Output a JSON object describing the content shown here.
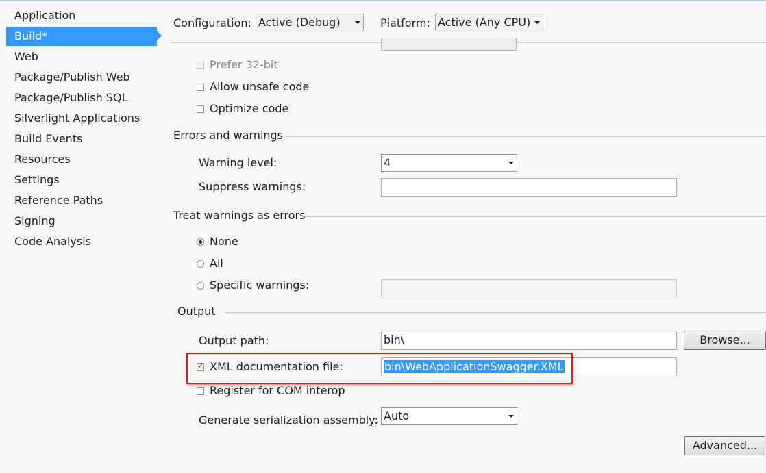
{
  "sidebar": {
    "items": [
      {
        "label": "Application"
      },
      {
        "label": "Build*"
      },
      {
        "label": "Web"
      },
      {
        "label": "Package/Publish Web"
      },
      {
        "label": "Package/Publish SQL"
      },
      {
        "label": "Silverlight Applications"
      },
      {
        "label": "Build Events"
      },
      {
        "label": "Resources"
      },
      {
        "label": "Settings"
      },
      {
        "label": "Reference Paths"
      },
      {
        "label": "Signing"
      },
      {
        "label": "Code Analysis"
      }
    ],
    "active_index": 1
  },
  "header": {
    "configuration_label": "Configuration:",
    "configuration_value": "Active (Debug)",
    "platform_label": "Platform:",
    "platform_value": "Active (Any CPU)"
  },
  "general": {
    "prefer32_label": "Prefer 32-bit",
    "unsafe_label": "Allow unsafe code",
    "optimize_label": "Optimize code"
  },
  "errors": {
    "title": "Errors and warnings",
    "warning_level_label": "Warning level:",
    "warning_level_value": "4",
    "suppress_label": "Suppress warnings:",
    "suppress_value": ""
  },
  "treat": {
    "title": "Treat warnings as errors",
    "none_label": "None",
    "all_label": "All",
    "specific_label": "Specific warnings:",
    "specific_value": ""
  },
  "output": {
    "title": "Output",
    "path_label": "Output path:",
    "path_value": "bin\\",
    "browse_label": "Browse...",
    "xml_label": "XML documentation file:",
    "xml_value": "bin\\WebApplicationSwagger.XML",
    "com_label": "Register for COM interop",
    "serialization_label": "Generate serialization assembly:",
    "serialization_value": "Auto",
    "advanced_label": "Advanced..."
  },
  "colors": {
    "accent": "#3399ff",
    "highlight_border": "#d42020"
  }
}
